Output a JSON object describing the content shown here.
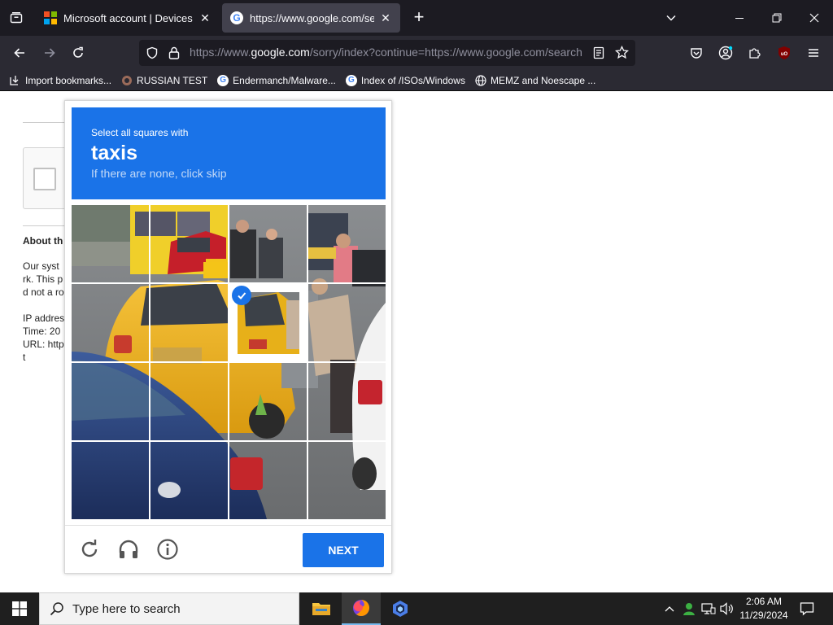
{
  "browser": {
    "tabs": [
      {
        "title": "Microsoft account | Devices",
        "active": false,
        "favicon": "microsoft-logo"
      },
      {
        "title": "https://www.google.com/search",
        "active": true,
        "favicon": "google-logo"
      }
    ],
    "url": {
      "prefix": "https://www.",
      "domain": "google.com",
      "rest": "/sorry/index?continue=https://www.google.com/search"
    },
    "bookmarks": [
      {
        "label": "Import bookmarks...",
        "icon": "import-icon"
      },
      {
        "label": "RUSSIAN TEST",
        "icon": "russian-test-icon"
      },
      {
        "label": "Endermanch/Malware...",
        "icon": "google-icon"
      },
      {
        "label": "Index of /ISOs/Windows",
        "icon": "google-icon"
      },
      {
        "label": "MEMZ and Noescape ...",
        "icon": "globe-icon"
      }
    ]
  },
  "page": {
    "about_heading": "About th",
    "para1": "Our syst\nrk. This p\nd not a ro",
    "para2": "IP addres\nTime: 20\nURL: http\nt"
  },
  "captcha": {
    "instruction": "Select all squares with",
    "target": "taxis",
    "hint": "If there are none, click skip",
    "selected_tiles": [
      6
    ],
    "next_label": "NEXT",
    "colors": {
      "accent": "#1a73e8",
      "taxi_yellow": "#f2b418"
    }
  },
  "taskbar": {
    "search_placeholder": "Type here to search",
    "time": "2:06 AM",
    "date": "11/29/2024"
  }
}
